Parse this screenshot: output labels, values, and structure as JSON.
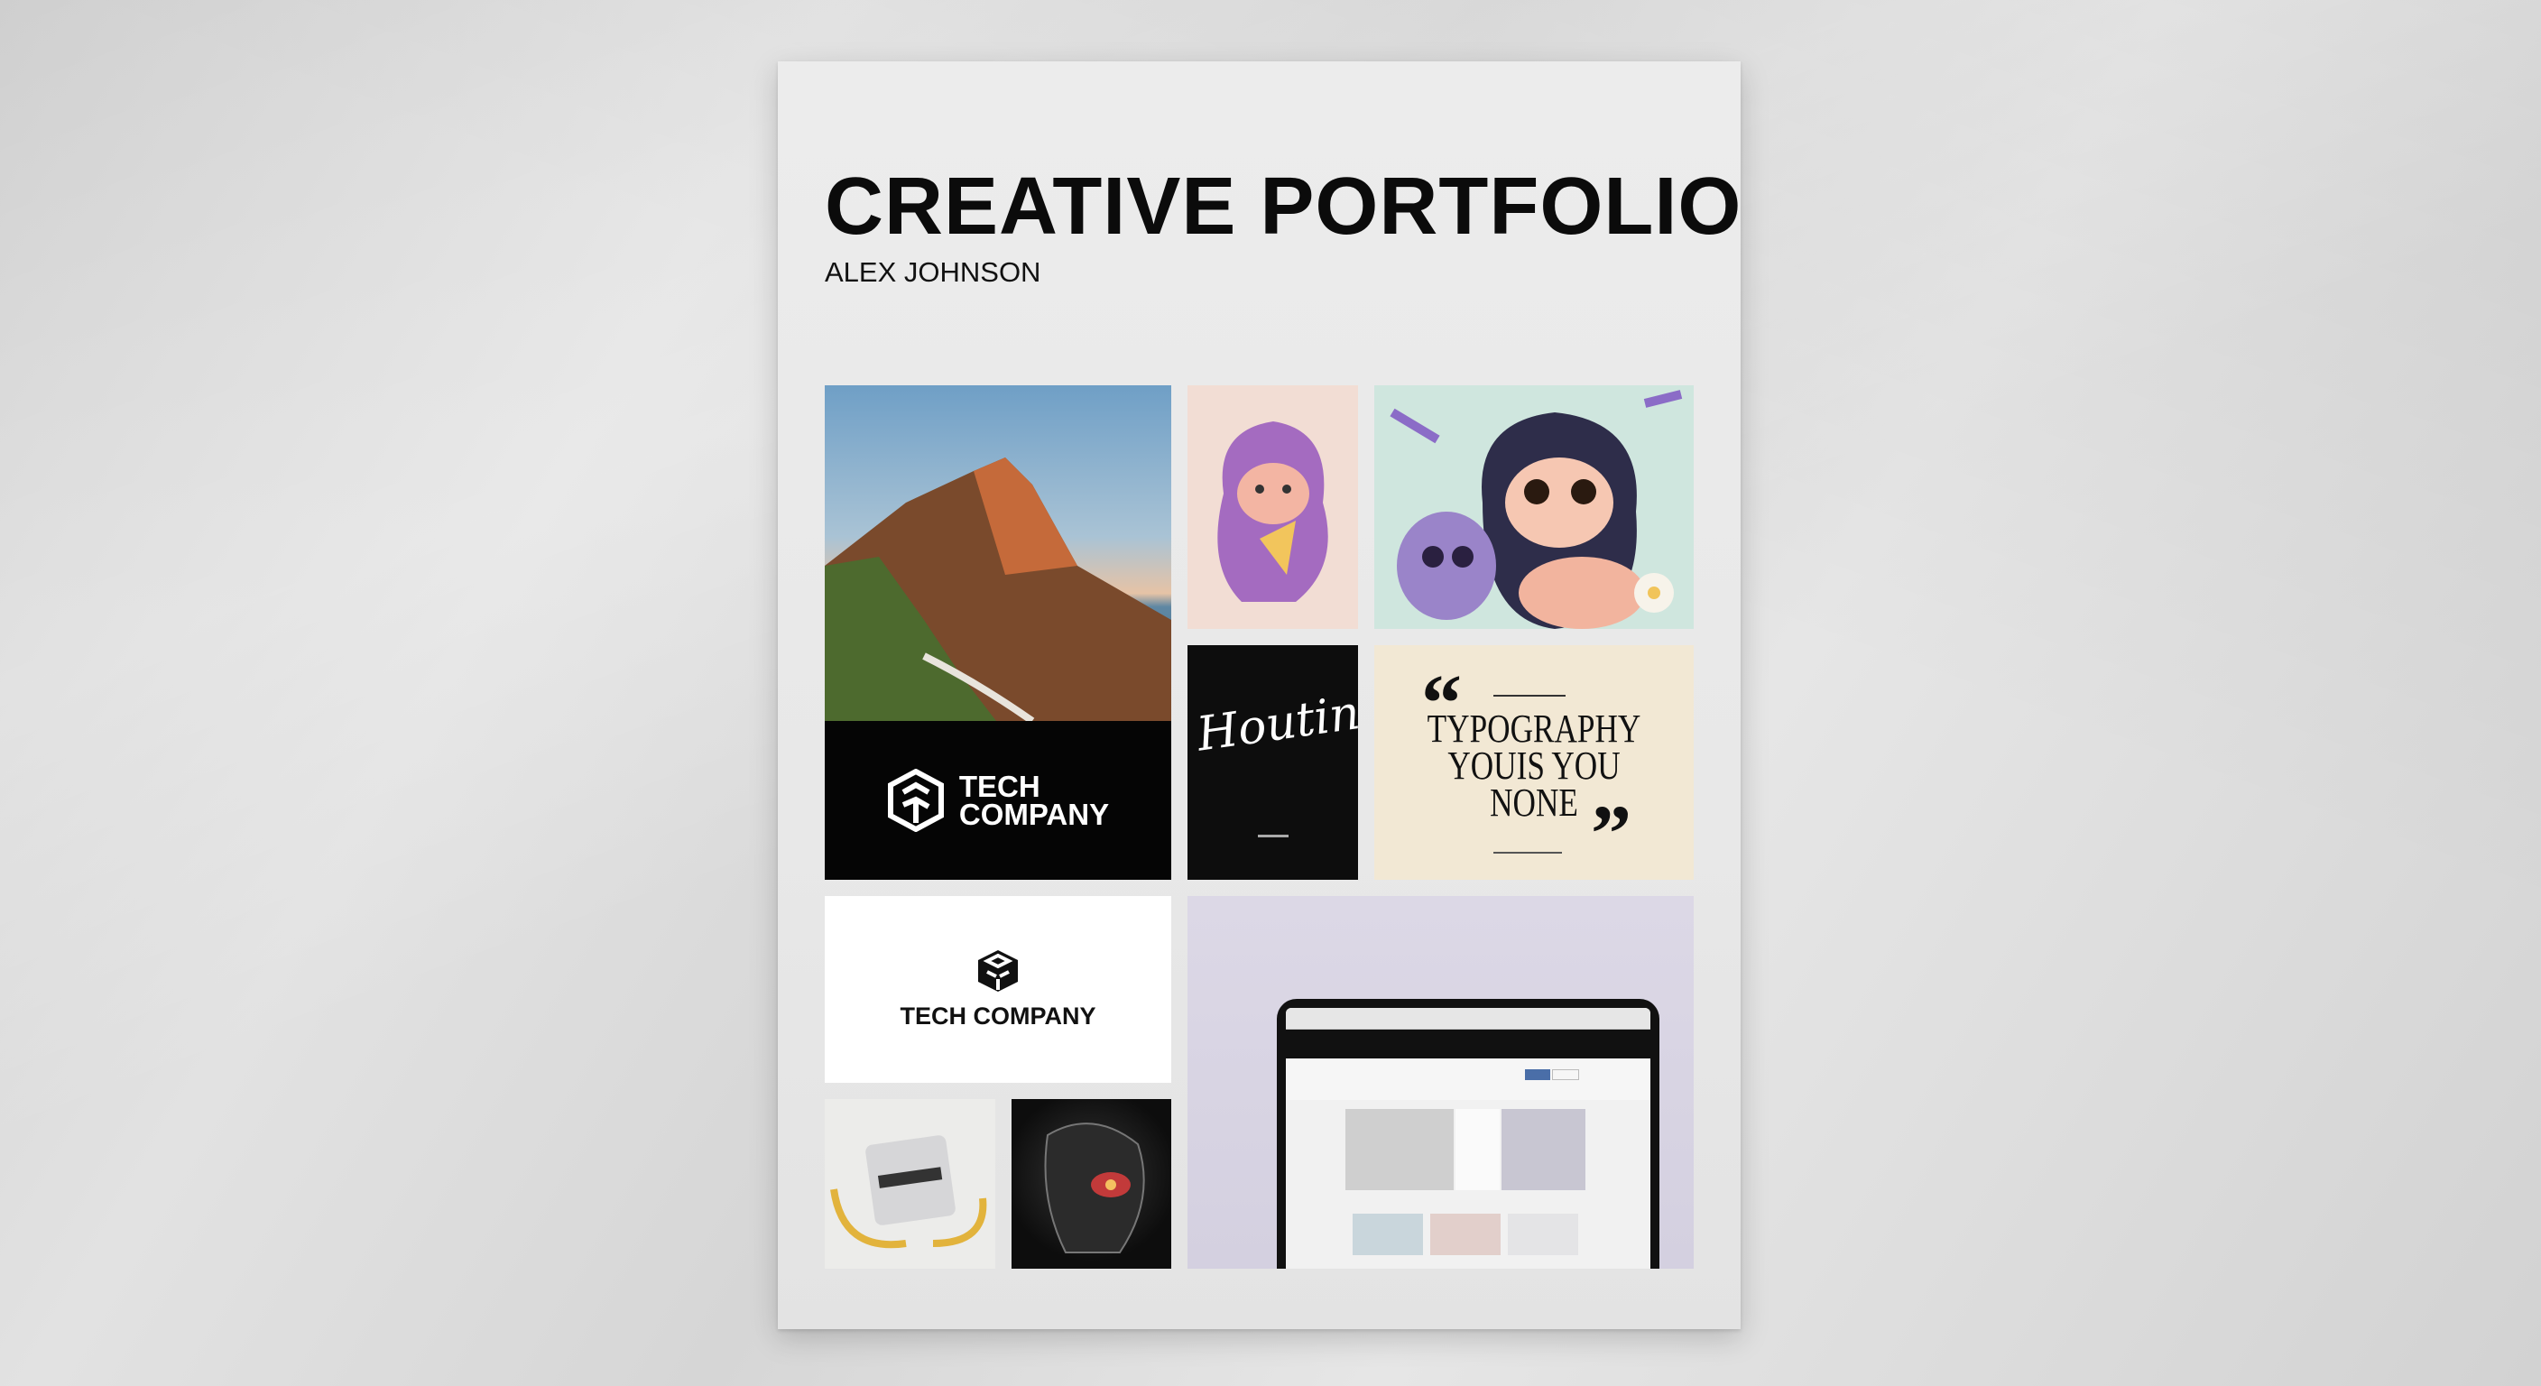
{
  "portfolio": {
    "title": "CREATIVE PORTFOLIO",
    "author": "ALEX JOHNSON"
  },
  "tiles": {
    "tech_black": {
      "line1": "TECH",
      "line2": "COMPANY"
    },
    "tech_white": {
      "name": "TECH COMPANY"
    },
    "calligraphy": {
      "script": "Houting"
    },
    "typography": {
      "line1": "TYPOGRAPHY",
      "line2": "YOUIS YOU",
      "line3": "NONE",
      "open_quote": "“",
      "close_quote": "”"
    }
  },
  "colors": {
    "wall": "#d9d9d9",
    "paper": "#eaeaea",
    "cream": "#f2e8d4",
    "lavender": "#d8d4e4"
  }
}
